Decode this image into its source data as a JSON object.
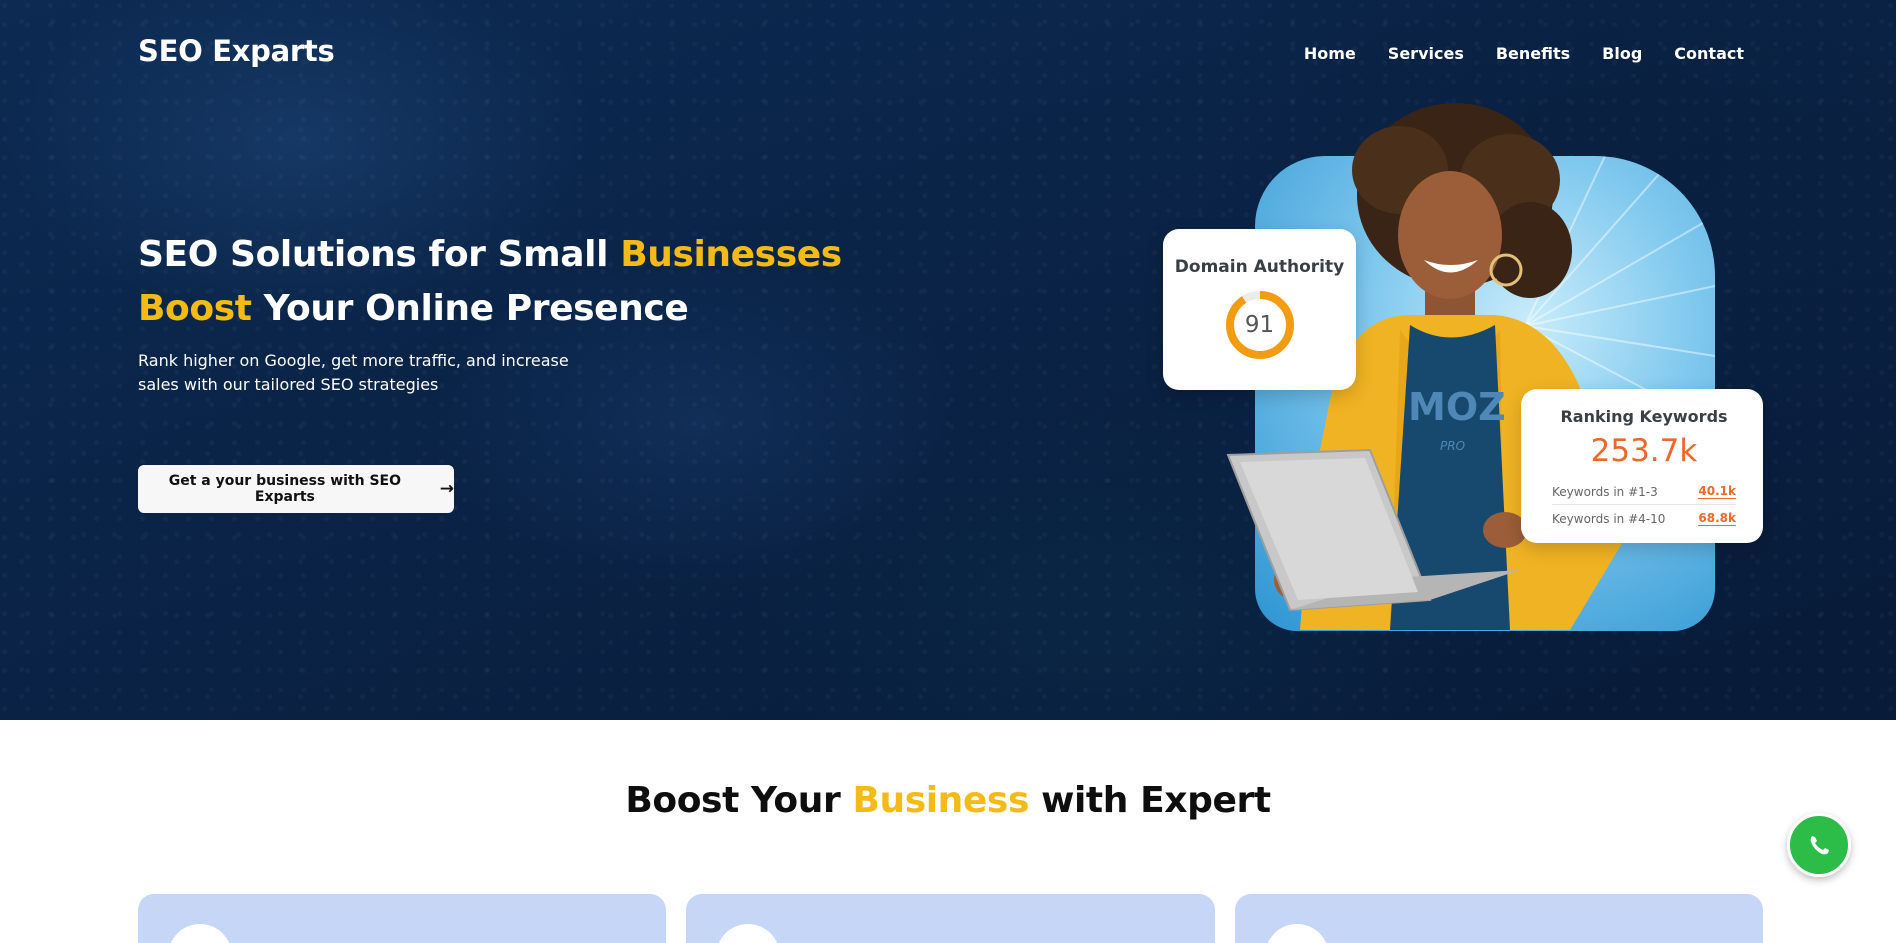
{
  "brand": "SEO Exparts",
  "nav": {
    "items": [
      "Home",
      "Services",
      "Benefits",
      "Blog",
      "Contact"
    ]
  },
  "hero": {
    "headline_part1": "SEO Solutions for Small ",
    "headline_hl1": "Businesses",
    "headline_hl2": "Boost",
    "headline_part2": " Your Online Presence",
    "subtext": "Rank higher on Google, get more traffic, and increase sales with our tailored SEO strategies",
    "cta_label": "Get a your business with SEO Exparts",
    "cta_icon": "arrow-right-icon"
  },
  "visual": {
    "shirt_text": "MOZ",
    "shirt_subtext": "PRO",
    "domain_authority": {
      "title": "Domain Authority",
      "value": "91"
    },
    "ranking": {
      "title": "Ranking Keywords",
      "value": "253.7k",
      "rows": [
        {
          "label": "Keywords in #1-3",
          "value": "40.1k"
        },
        {
          "label": "Keywords in #4-10",
          "value": "68.8k"
        }
      ]
    }
  },
  "section": {
    "title_part1": "Boost Your ",
    "title_hl": "Business",
    "title_part2": " with Expert"
  },
  "floating": {
    "icon": "whatsapp-icon"
  },
  "colors": {
    "accent": "#f4bb16",
    "hero_bg": "#0a2346",
    "orange": "#ea6a2a",
    "card_bg": "#c6d6f6",
    "whatsapp": "#2bbd48"
  }
}
